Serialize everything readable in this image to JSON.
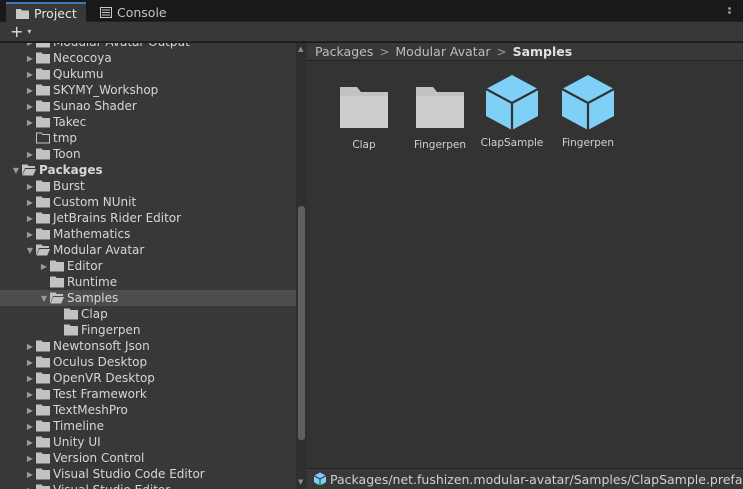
{
  "tabs": [
    {
      "label": "Project",
      "icon": "folder-icon",
      "active": true
    },
    {
      "label": "Console",
      "icon": "console-icon",
      "active": false
    }
  ],
  "toolbar": {
    "add_label": "+",
    "add_caret": "▾"
  },
  "tree": {
    "rows": [
      {
        "label": "Modular Avatar Output",
        "indent": 1,
        "arrow": "collapsed",
        "icon": "folder"
      },
      {
        "label": "Necocoya",
        "indent": 1,
        "arrow": "collapsed",
        "icon": "folder"
      },
      {
        "label": "Qukumu",
        "indent": 1,
        "arrow": "collapsed",
        "icon": "folder"
      },
      {
        "label": "SKYMY_Workshop",
        "indent": 1,
        "arrow": "collapsed",
        "icon": "folder"
      },
      {
        "label": "Sunao Shader",
        "indent": 1,
        "arrow": "collapsed",
        "icon": "folder"
      },
      {
        "label": "Takec",
        "indent": 1,
        "arrow": "collapsed",
        "icon": "folder"
      },
      {
        "label": "tmp",
        "indent": 1,
        "arrow": "none",
        "icon": "folder-empty"
      },
      {
        "label": "Toon",
        "indent": 1,
        "arrow": "collapsed",
        "icon": "folder"
      },
      {
        "label": "Packages",
        "indent": 0,
        "arrow": "expanded",
        "icon": "folder-open",
        "bold": true
      },
      {
        "label": "Burst",
        "indent": 1,
        "arrow": "collapsed",
        "icon": "folder"
      },
      {
        "label": "Custom NUnit",
        "indent": 1,
        "arrow": "collapsed",
        "icon": "folder"
      },
      {
        "label": "JetBrains Rider Editor",
        "indent": 1,
        "arrow": "collapsed",
        "icon": "folder"
      },
      {
        "label": "Mathematics",
        "indent": 1,
        "arrow": "collapsed",
        "icon": "folder"
      },
      {
        "label": "Modular Avatar",
        "indent": 1,
        "arrow": "expanded",
        "icon": "folder-open"
      },
      {
        "label": "Editor",
        "indent": 2,
        "arrow": "collapsed",
        "icon": "folder"
      },
      {
        "label": "Runtime",
        "indent": 2,
        "arrow": "none",
        "icon": "folder"
      },
      {
        "label": "Samples",
        "indent": 2,
        "arrow": "expanded",
        "icon": "folder-open",
        "selected": true
      },
      {
        "label": "Clap",
        "indent": 3,
        "arrow": "none",
        "icon": "folder"
      },
      {
        "label": "Fingerpen",
        "indent": 3,
        "arrow": "none",
        "icon": "folder"
      },
      {
        "label": "Newtonsoft Json",
        "indent": 1,
        "arrow": "collapsed",
        "icon": "folder"
      },
      {
        "label": "Oculus Desktop",
        "indent": 1,
        "arrow": "collapsed",
        "icon": "folder"
      },
      {
        "label": "OpenVR Desktop",
        "indent": 1,
        "arrow": "collapsed",
        "icon": "folder"
      },
      {
        "label": "Test Framework",
        "indent": 1,
        "arrow": "collapsed",
        "icon": "folder"
      },
      {
        "label": "TextMeshPro",
        "indent": 1,
        "arrow": "collapsed",
        "icon": "folder"
      },
      {
        "label": "Timeline",
        "indent": 1,
        "arrow": "collapsed",
        "icon": "folder"
      },
      {
        "label": "Unity UI",
        "indent": 1,
        "arrow": "collapsed",
        "icon": "folder"
      },
      {
        "label": "Version Control",
        "indent": 1,
        "arrow": "collapsed",
        "icon": "folder"
      },
      {
        "label": "Visual Studio Code Editor",
        "indent": 1,
        "arrow": "collapsed",
        "icon": "folder"
      },
      {
        "label": "Visual Studio Editor",
        "indent": 1,
        "arrow": "collapsed",
        "icon": "folder"
      }
    ]
  },
  "breadcrumb": {
    "items": [
      "Packages",
      "Modular Avatar",
      "Samples"
    ],
    "separator": ">"
  },
  "assets": [
    {
      "name": "Clap",
      "type": "folder"
    },
    {
      "name": "Fingerpen",
      "type": "folder"
    },
    {
      "name": "ClapSample",
      "type": "prefab"
    },
    {
      "name": "Fingerpen",
      "type": "prefab"
    }
  ],
  "status": {
    "path": "Packages/net.fushizen.modular-avatar/Samples/ClapSample.prefab",
    "icon": "prefab-icon"
  },
  "colors": {
    "accent": "#3a79bb",
    "prefab": "#7fd0f6",
    "folder": "#c2c2c2",
    "selected": "#4d4d4d"
  }
}
